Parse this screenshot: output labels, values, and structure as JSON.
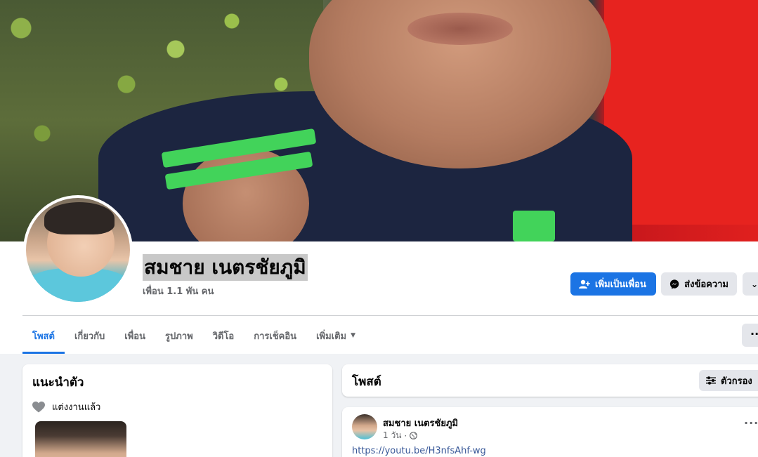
{
  "profile": {
    "name": "สมชาย เนตรชัยภูมิ",
    "friends_count": "เพื่อน 1.1 พัน คน"
  },
  "actions": {
    "add_friend": "เพิ่มเป็นเพื่อน",
    "message": "ส่งข้อความ"
  },
  "tabs": [
    {
      "label": "โพสต์",
      "active": true
    },
    {
      "label": "เกี่ยวกับ",
      "active": false
    },
    {
      "label": "เพื่อน",
      "active": false
    },
    {
      "label": "รูปภาพ",
      "active": false
    },
    {
      "label": "วิดีโอ",
      "active": false
    },
    {
      "label": "การเช็คอิน",
      "active": false
    },
    {
      "label": "เพิ่มเติม",
      "active": false
    }
  ],
  "intro": {
    "title": "แนะนำตัว",
    "relationship": "แต่งงานแล้ว"
  },
  "posts_header": {
    "title": "โพสต์",
    "filter_label": "ตัวกรอง"
  },
  "post": {
    "author": "สมชาย เนตรชัยภูมิ",
    "time": "1 วัน",
    "link": "https://youtu.be/H3nfsAhf-wg"
  },
  "colors": {
    "accent": "#1b74e4",
    "page_bg": "#f0f2f5",
    "secondary_button": "#e4e6eb",
    "muted_text": "#65676b"
  }
}
